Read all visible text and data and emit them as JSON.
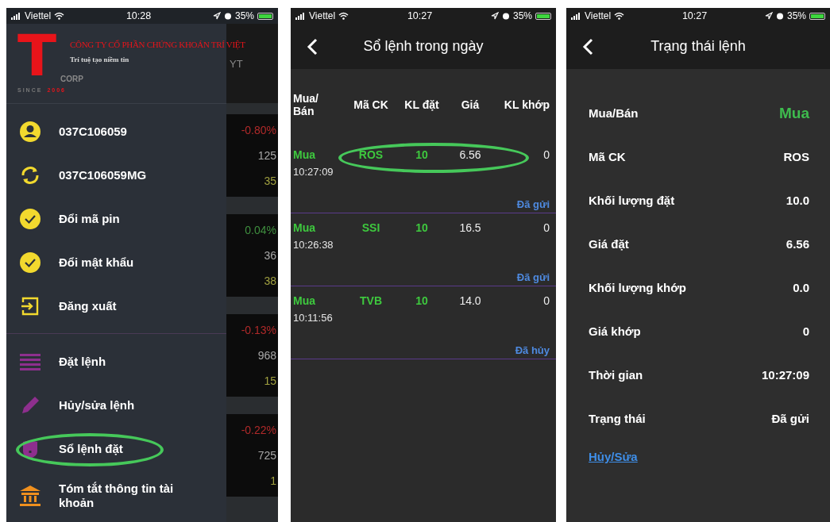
{
  "screens": [
    {
      "status_bar": {
        "carrier": "Viettel",
        "time": "10:28",
        "battery": "35%"
      },
      "logo": {
        "letter": "T",
        "company": "CÔNG TY CỔ PHẦN CHỨNG KHOÁN TRÍ VIỆT",
        "slogan": "Trí tuệ tạo niềm tin",
        "corp": "CORP",
        "since": "SINCE",
        "year": "2006"
      },
      "menu_groups": [
        [
          {
            "kind": "account",
            "label": "037C106059",
            "highlighted": false
          },
          {
            "kind": "subaccount",
            "label": "037C106059MG",
            "highlighted": false
          },
          {
            "kind": "pin",
            "label": "Đổi mã pin",
            "highlighted": false
          },
          {
            "kind": "password",
            "label": "Đổi mật khẩu",
            "highlighted": false
          },
          {
            "kind": "logout",
            "label": "Đăng xuất",
            "highlighted": false
          }
        ],
        [
          {
            "kind": "order",
            "label": "Đặt lệnh",
            "highlighted": false
          },
          {
            "kind": "edit",
            "label": "Hủy/sửa lệnh",
            "highlighted": false
          },
          {
            "kind": "orderbook",
            "label": "Sổ lệnh đặt",
            "highlighted": true
          },
          {
            "kind": "summary",
            "label": "Tóm tắt thông tin tài khoản",
            "highlighted": false
          }
        ]
      ],
      "background_app": {
        "header": "YT",
        "groups": [
          [
            {
              "text": "-0.80%",
              "color": "#b02a2a"
            },
            {
              "text": "125",
              "color": "#a8a8a8"
            },
            {
              "text": "35",
              "color": "#a0a040"
            }
          ],
          [
            {
              "text": "0.04%",
              "color": "#3f8f3f"
            },
            {
              "text": "36",
              "color": "#a8a8a8"
            },
            {
              "text": "38",
              "color": "#a0a040"
            }
          ],
          [
            {
              "text": "-0.13%",
              "color": "#b02a2a"
            },
            {
              "text": "968",
              "color": "#a8a8a8"
            },
            {
              "text": "15",
              "color": "#a0a040"
            }
          ],
          [
            {
              "text": "-0.22%",
              "color": "#b02a2a"
            },
            {
              "text": "725",
              "color": "#a8a8a8"
            },
            {
              "text": "1",
              "color": "#a0a040"
            }
          ]
        ]
      }
    },
    {
      "status_bar": {
        "carrier": "Viettel",
        "time": "10:27",
        "battery": "35%"
      },
      "title": "Sổ lệnh trong ngày",
      "columns": [
        "Mua/ Bán",
        "Mã CK",
        "KL đặt",
        "Giá",
        "KL khớp"
      ],
      "rows": [
        {
          "side": "Mua",
          "time": "10:27:09",
          "code": "ROS",
          "quantity": "10",
          "price": "6.56",
          "matched": "0",
          "status": "Đã gửi",
          "highlighted": true
        },
        {
          "side": "Mua",
          "time": "10:26:38",
          "code": "SSI",
          "quantity": "10",
          "price": "16.5",
          "matched": "0",
          "status": "Đã gửi",
          "highlighted": false
        },
        {
          "side": "Mua",
          "time": "10:11:56",
          "code": "TVB",
          "quantity": "10",
          "price": "14.0",
          "matched": "0",
          "status": "Đã hủy",
          "highlighted": false
        }
      ]
    },
    {
      "status_bar": {
        "carrier": "Viettel",
        "time": "10:27",
        "battery": "35%"
      },
      "title": "Trạng thái lệnh",
      "fields": [
        {
          "label": "Mua/Bán",
          "value": "Mua",
          "kind": "side"
        },
        {
          "label": "Mã CK",
          "value": "ROS",
          "kind": "plain"
        },
        {
          "label": "Khối lượng đặt",
          "value": "10.0",
          "kind": "plain"
        },
        {
          "label": "Giá đặt",
          "value": "6.56",
          "kind": "plain"
        },
        {
          "label": "Khối lượng khớp",
          "value": "0.0",
          "kind": "plain"
        },
        {
          "label": "Giá khớp",
          "value": "0",
          "kind": "plain"
        },
        {
          "label": "Thời gian",
          "value": "10:27:09",
          "kind": "plain"
        },
        {
          "label": "Trạng thái",
          "value": "Đã gửi",
          "kind": "plain"
        }
      ],
      "link": "Hủy/Sửa"
    }
  ]
}
